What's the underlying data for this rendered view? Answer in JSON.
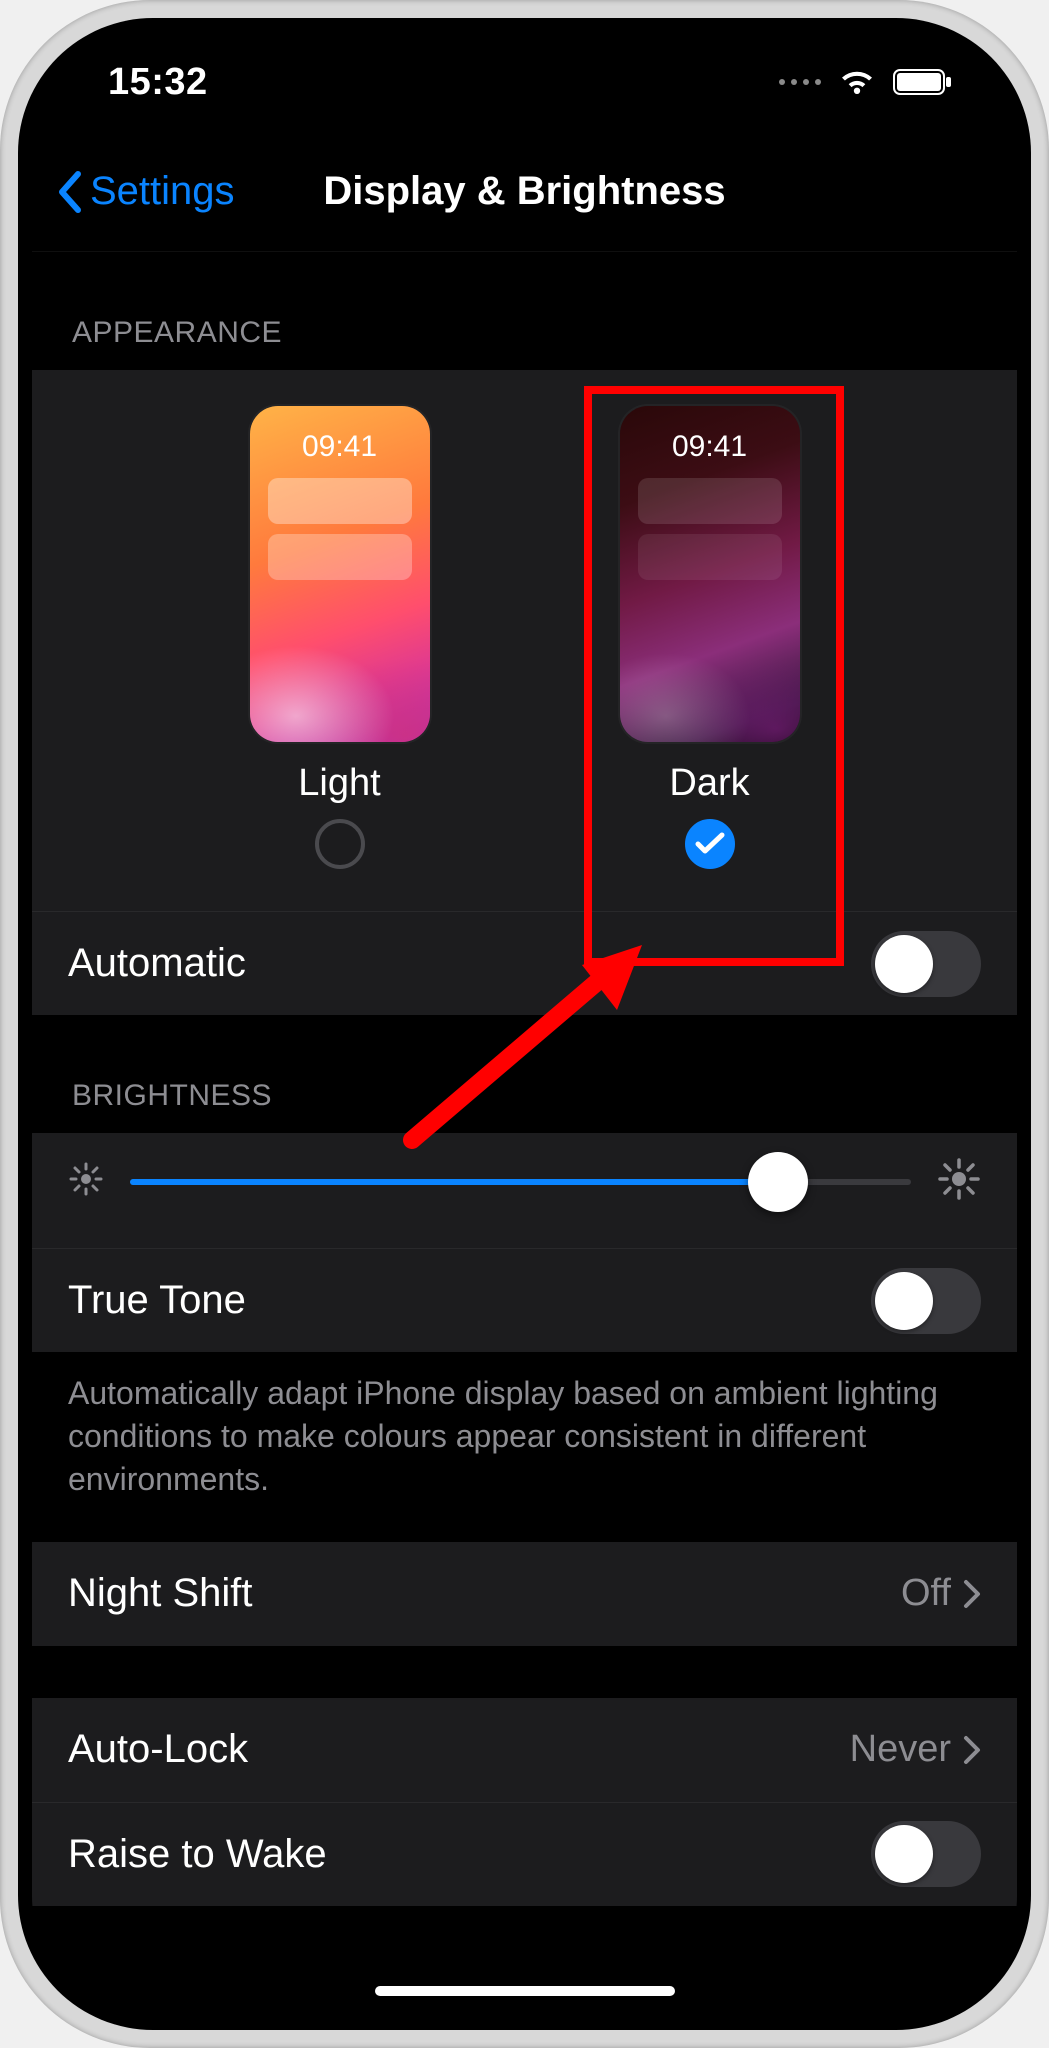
{
  "status": {
    "time": "15:32"
  },
  "nav": {
    "back_label": "Settings",
    "title": "Display & Brightness"
  },
  "appearance": {
    "header": "APPEARANCE",
    "preview_time": "09:41",
    "options": [
      {
        "label": "Light",
        "selected": false
      },
      {
        "label": "Dark",
        "selected": true
      }
    ],
    "automatic": {
      "label": "Automatic",
      "on": false
    }
  },
  "brightness": {
    "header": "BRIGHTNESS",
    "value_percent": 83,
    "true_tone": {
      "label": "True Tone",
      "on": false
    },
    "description": "Automatically adapt iPhone display based on ambient lighting conditions to make colours appear consistent in different environments."
  },
  "night_shift": {
    "label": "Night Shift",
    "value": "Off"
  },
  "auto_lock": {
    "label": "Auto-Lock",
    "value": "Never"
  },
  "raise_to_wake": {
    "label": "Raise to Wake",
    "on": false
  }
}
